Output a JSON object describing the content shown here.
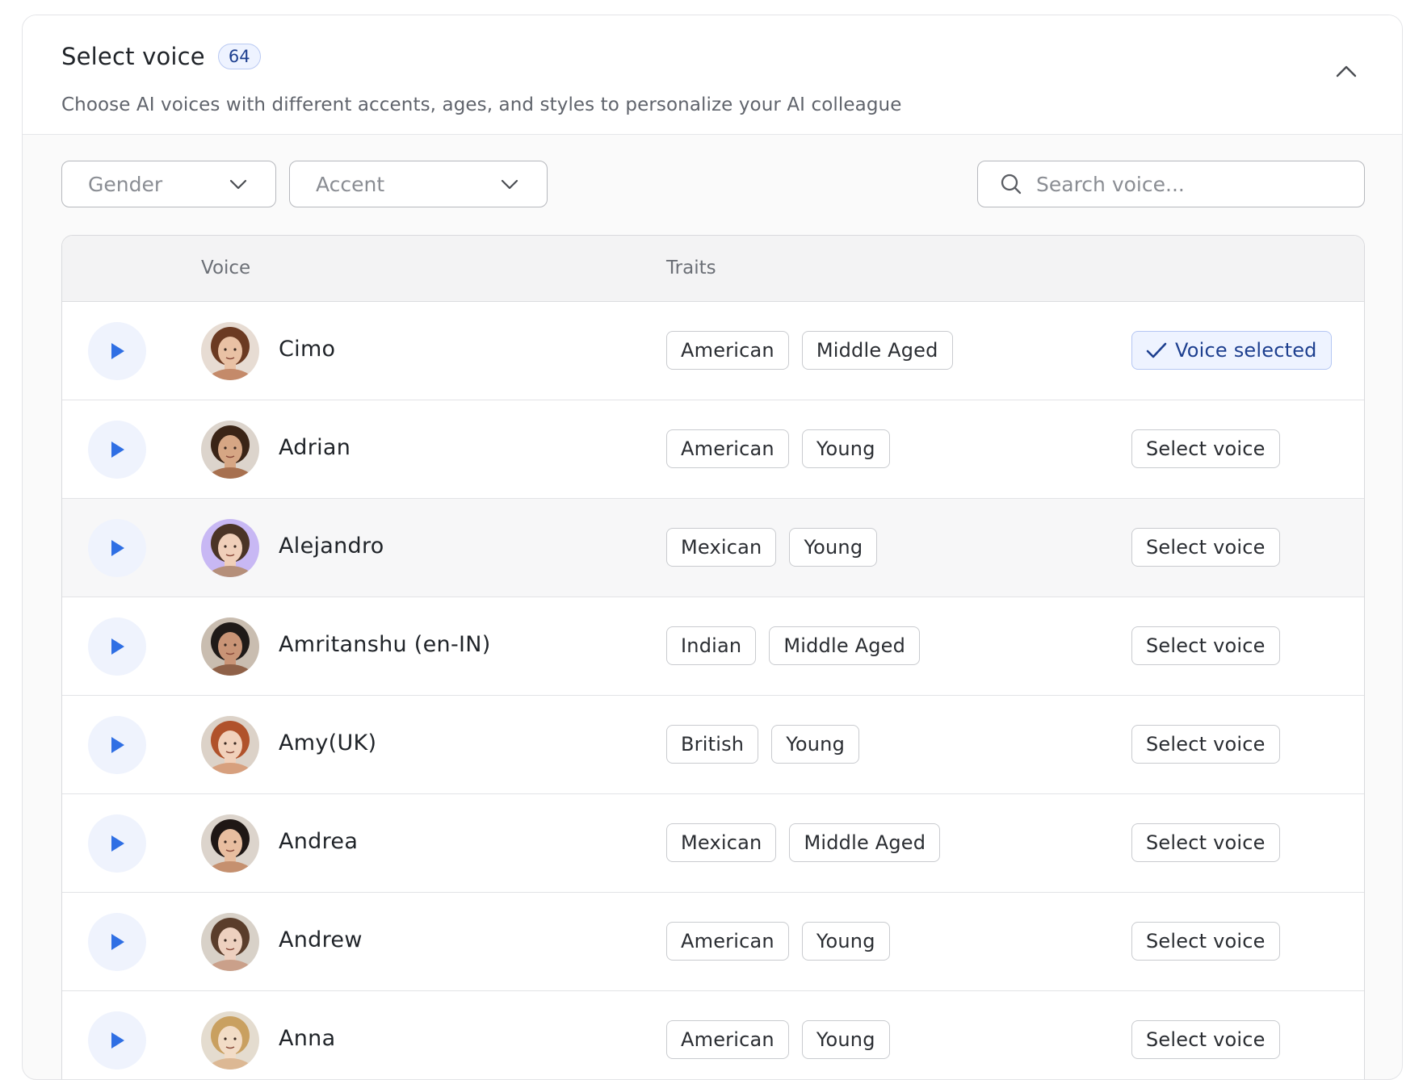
{
  "header": {
    "title": "Select voice",
    "count": "64",
    "subtitle": "Choose AI voices with different accents, ages, and styles to personalize your AI colleague",
    "collapse_icon": "chevron-up-icon"
  },
  "filters": {
    "gender_label": "Gender",
    "accent_label": "Accent",
    "search_placeholder": "Search voice..."
  },
  "table": {
    "columns": {
      "voice": "Voice",
      "traits": "Traits"
    },
    "rows": [
      {
        "name": "Cimo",
        "traits": [
          "American",
          "Middle Aged"
        ],
        "action": "Voice selected",
        "selected": true
      },
      {
        "name": "Adrian",
        "traits": [
          "American",
          "Young"
        ],
        "action": "Select voice",
        "selected": false
      },
      {
        "name": "Alejandro",
        "traits": [
          "Mexican",
          "Young"
        ],
        "action": "Select voice",
        "selected": false
      },
      {
        "name": "Amritanshu (en-IN)",
        "traits": [
          "Indian",
          "Middle Aged"
        ],
        "action": "Select voice",
        "selected": false
      },
      {
        "name": "Amy(UK)",
        "traits": [
          "British",
          "Young"
        ],
        "action": "Select voice",
        "selected": false
      },
      {
        "name": "Andrea",
        "traits": [
          "Mexican",
          "Middle Aged"
        ],
        "action": "Select voice",
        "selected": false
      },
      {
        "name": "Andrew",
        "traits": [
          "American",
          "Young"
        ],
        "action": "Select voice",
        "selected": false
      },
      {
        "name": "Anna",
        "traits": [
          "American",
          "Young"
        ],
        "action": "Select voice",
        "selected": false
      }
    ]
  },
  "colors": {
    "accent_blue": "#2f6fe4",
    "selected_bg": "#eef3ff",
    "selected_text": "#1d3f8f"
  }
}
